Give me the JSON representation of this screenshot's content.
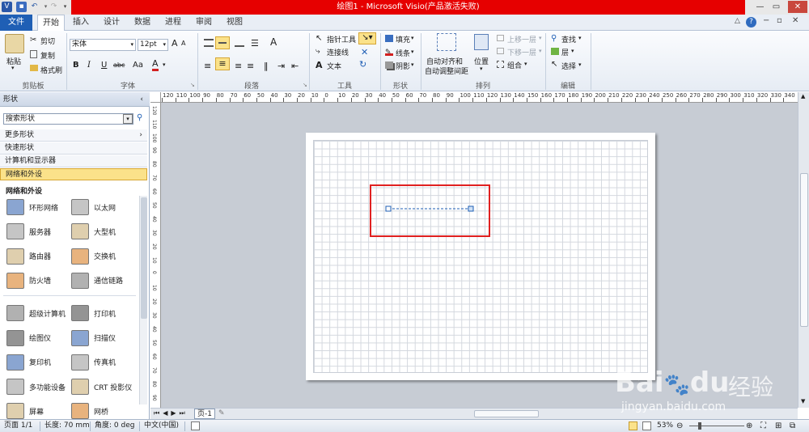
{
  "title": "绘图1 - Microsoft Visio(产品激活失败)",
  "window_controls": {
    "minimize": "—",
    "maximize": "▭",
    "close": "✕"
  },
  "tabs": [
    "文件",
    "开始",
    "插入",
    "设计",
    "数据",
    "进程",
    "审阅",
    "视图"
  ],
  "ribbon": {
    "clipboard": {
      "paste": "粘贴",
      "cut": "剪切",
      "copy": "复制",
      "format_painter": "格式刷",
      "label": "剪贴板"
    },
    "font": {
      "name": "宋体",
      "size": "12pt",
      "bold": "B",
      "italic": "I",
      "underline": "U",
      "strike": "abc",
      "case": "Aa",
      "color": "A",
      "grow": "A",
      "shrink": "A",
      "label": "字体"
    },
    "paragraph": {
      "label": "段落"
    },
    "tools": {
      "pointer": "指针工具",
      "connector": "连接线",
      "text": "文本",
      "label": "工具"
    },
    "shape": {
      "fill": "填充",
      "line": "线条",
      "shadow": "阴影",
      "label": "形状"
    },
    "arrange": {
      "auto_align": "自动对齐和",
      "auto_align2": "自动调整间距",
      "position": "位置",
      "bring_forward": "上移一层",
      "send_backward": "下移一层",
      "group": "组合",
      "label": "排列"
    },
    "editing": {
      "find": "查找",
      "layer": "层",
      "select": "选择",
      "label": "编辑"
    }
  },
  "panel": {
    "header": "形状",
    "search_value": "搜索形状",
    "rows": [
      "更多形状",
      "快速形状",
      "计算机和显示器",
      "网络和外设"
    ],
    "section_title": "网络和外设",
    "shapes": [
      [
        "环形网络",
        "以太网"
      ],
      [
        "服务器",
        "大型机"
      ],
      [
        "路由器",
        "交换机"
      ],
      [
        "防火墙",
        "通信链路"
      ],
      [
        "超级计算机",
        "打印机"
      ],
      [
        "绘图仪",
        "扫描仪"
      ],
      [
        "复印机",
        "传真机"
      ],
      [
        "多功能设备",
        "CRT 投影仪"
      ],
      [
        "屏幕",
        "网桥"
      ]
    ]
  },
  "ruler_labels": [
    "120",
    "110",
    "100",
    "90",
    "80",
    "70",
    "60",
    "50",
    "40",
    "30",
    "20",
    "10",
    "0",
    "10",
    "20",
    "30",
    "40",
    "50",
    "60",
    "70",
    "80",
    "90",
    "100",
    "110",
    "120",
    "130",
    "140",
    "150",
    "160",
    "170",
    "180",
    "190",
    "200",
    "210",
    "220",
    "230",
    "240",
    "250",
    "260",
    "270",
    "280",
    "290",
    "300",
    "310",
    "320",
    "330",
    "340"
  ],
  "page_tab": "页-1",
  "status": {
    "page": "页面 1/1",
    "length": "长度: 70 mm",
    "angle": "角度: 0 deg",
    "language": "中文(中国)",
    "zoom": "53%"
  },
  "watermark": {
    "brand": "Bai",
    "brand2": "du",
    "cn": "经验",
    "url": "jingyan.baidu.com"
  },
  "colors": {
    "accent_file": "#1f5fb5",
    "title_red": "#e60000",
    "highlight": "#fbe28a",
    "selection_box": "#e02020"
  }
}
